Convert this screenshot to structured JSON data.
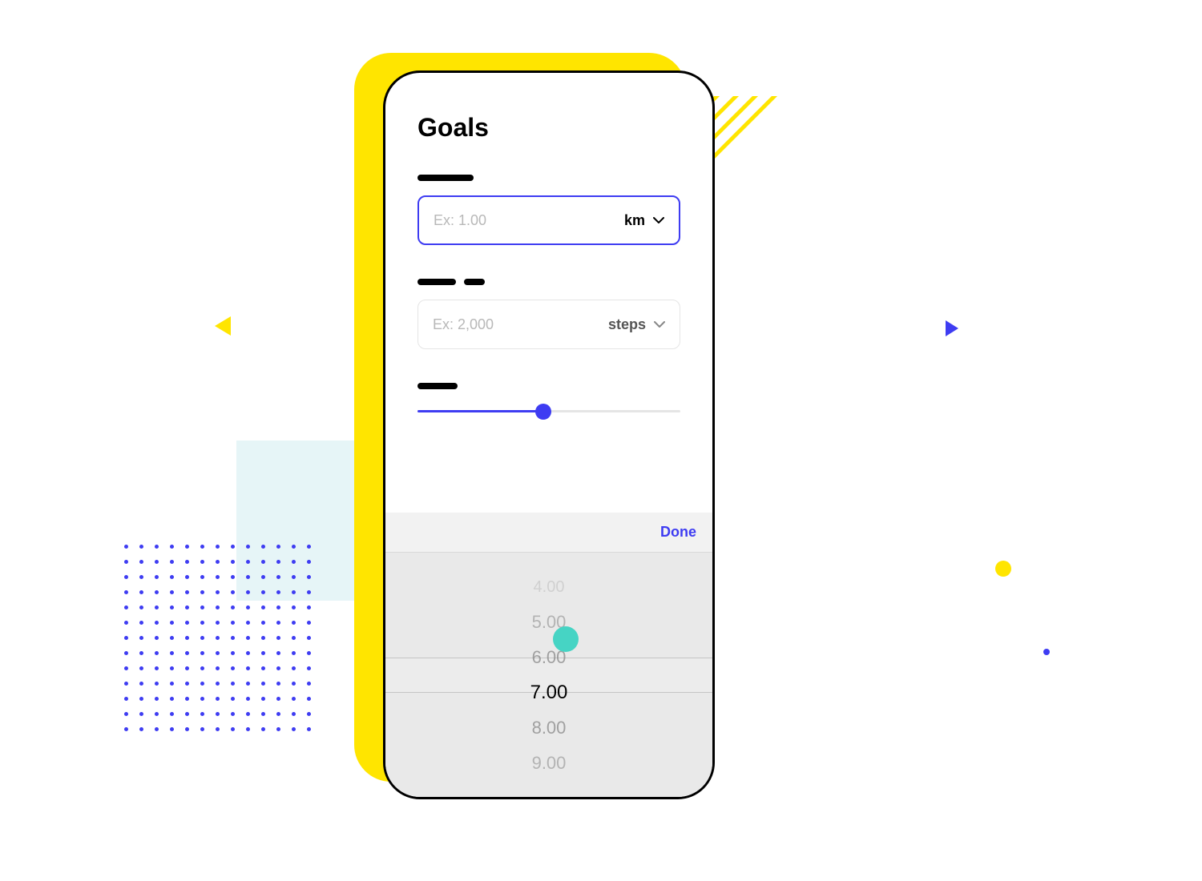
{
  "screen": {
    "title": "Goals"
  },
  "fields": {
    "distance": {
      "placeholder": "Ex: 1.00",
      "unit": "km"
    },
    "steps": {
      "placeholder": "Ex: 2,000",
      "unit": "steps"
    }
  },
  "picker": {
    "done_label": "Done",
    "options": [
      "4.00",
      "5.00",
      "6.00",
      "7.00",
      "8.00",
      "9.00"
    ],
    "selected": "7.00"
  },
  "slider": {
    "percent": 48
  }
}
